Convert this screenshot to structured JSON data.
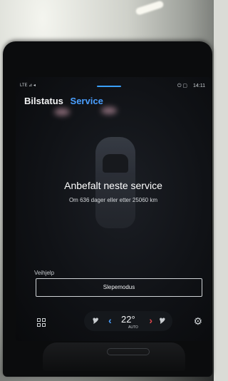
{
  "status": {
    "signal": "LTE ⊿ ◂",
    "icons": "⏻ ▢",
    "time": "14:11"
  },
  "tabs": [
    {
      "label": "Bilstatus",
      "active": false
    },
    {
      "label": "Service",
      "active": true
    }
  ],
  "service": {
    "title": "Anbefalt neste service",
    "subtitle": "Om 636 dager eller etter 25060 km"
  },
  "tow": {
    "label": "Veihjelp",
    "button_label": "Slepemodus"
  },
  "climate": {
    "temperature": "22°",
    "fan_mode": "AUTO",
    "left_arrow": "‹",
    "right_arrow": "›",
    "left_seat": "🎔",
    "right_seat": "🎔"
  },
  "colors": {
    "accent": "#4a9fff",
    "warm": "#e0474c"
  }
}
